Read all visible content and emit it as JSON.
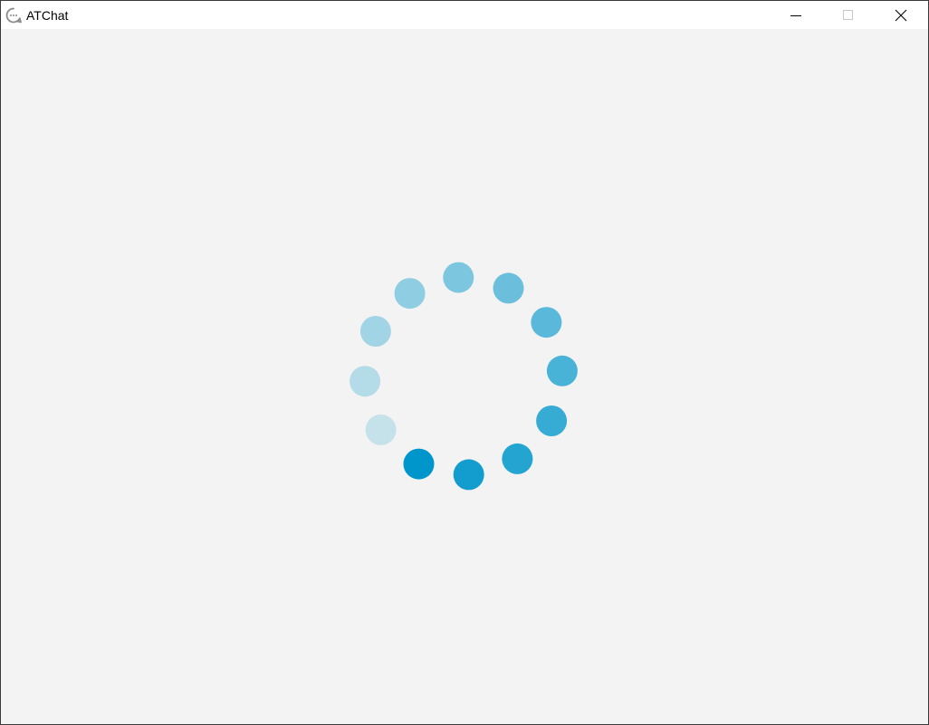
{
  "window": {
    "title": "ATChat",
    "app_icon": "chat-bubble-icon",
    "controls": {
      "minimize_icon": "minimize-icon",
      "maximize_icon": "maximize-icon",
      "close_icon": "close-icon"
    }
  },
  "loading_spinner": {
    "icon": "loading-spinner-icon",
    "dot_count": 12,
    "colors": {
      "accent": "#0096CB",
      "faint": "#C5E2EB",
      "background": "#F3F3F3"
    }
  }
}
